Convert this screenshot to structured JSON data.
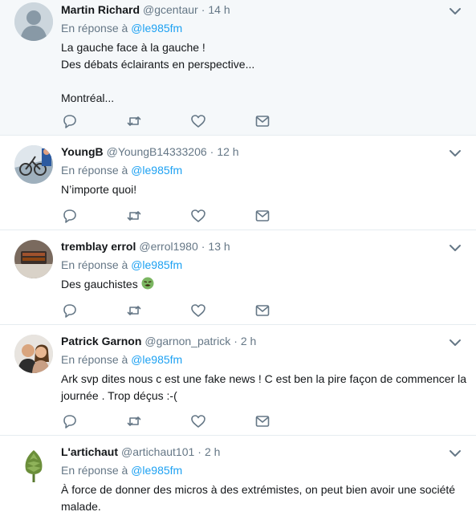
{
  "tweets": [
    {
      "name": "Martin Richard",
      "handle": "@gcentaur",
      "separator": "·",
      "time": "14 h",
      "reply_prefix": "En réponse à",
      "reply_to": "@le985fm",
      "lines": [
        "La gauche face à la gauche !",
        "Des débats éclairants en perspective...",
        "",
        "Montréal..."
      ]
    },
    {
      "name": "YoungB",
      "handle": "@YoungB14333206",
      "separator": "·",
      "time": "12 h",
      "reply_prefix": "En réponse à",
      "reply_to": "@le985fm",
      "lines": [
        "N’importe quoi!"
      ]
    },
    {
      "name": "tremblay errol",
      "handle": "@errol1980",
      "separator": "·",
      "time": "13 h",
      "reply_prefix": "En réponse à",
      "reply_to": "@le985fm",
      "lines": [
        "Des gauchistes"
      ],
      "emoji": "nauseated-face-emoji"
    },
    {
      "name": "Patrick Garnon",
      "handle": "@garnon_patrick",
      "separator": "·",
      "time": "2 h",
      "reply_prefix": "En réponse à",
      "reply_to": "@le985fm",
      "lines": [
        "Ark svp dites nous c est une fake news ! C est ben la pire façon de commencer la",
        "journée . Trop déçus :-("
      ]
    },
    {
      "name": "L'artichaut",
      "handle": "@artichaut101",
      "separator": "·",
      "time": "2 h",
      "reply_prefix": "En réponse à",
      "reply_to": "@le985fm",
      "lines": [
        "À force de donner des micros à des extrémistes, on peut bien avoir une société",
        "malade."
      ]
    }
  ],
  "colors": {
    "link": "#1da1f2",
    "muted": "#657786",
    "text": "#14171a",
    "highlight_bg": "#f5f8fa",
    "divider": "#e6ecf0"
  },
  "icons": {
    "reply": "reply-icon",
    "retweet": "retweet-icon",
    "like": "heart-icon",
    "message": "envelope-icon",
    "more": "chevron-down-icon"
  }
}
